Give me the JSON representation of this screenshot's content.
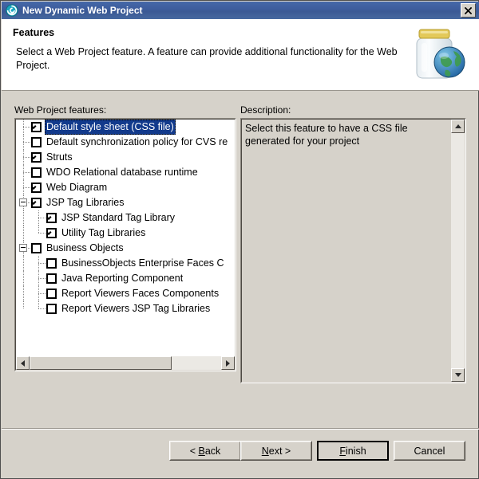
{
  "window": {
    "title": "New Dynamic Web Project",
    "icon": "spiral-icon",
    "close_label": "×",
    "title_bar_color": "#3d5c9c"
  },
  "header": {
    "title": "Features",
    "description": "Select a Web Project feature.  A feature can provide additional functionality for the Web Project.",
    "icon": "jar-globe-icon"
  },
  "labels": {
    "features": "Web Project features:",
    "description": "Description:"
  },
  "tree": {
    "selected_index": 0,
    "selection_color": "#123a8c",
    "items": [
      {
        "label": "Default style sheet (CSS file)",
        "checked": true,
        "level": 0,
        "expander": false,
        "selected": true
      },
      {
        "label": "Default synchronization policy for CVS re",
        "checked": false,
        "level": 0,
        "expander": false,
        "selected": false
      },
      {
        "label": "Struts",
        "checked": true,
        "level": 0,
        "expander": false,
        "selected": false
      },
      {
        "label": "WDO Relational database runtime",
        "checked": false,
        "level": 0,
        "expander": false,
        "selected": false
      },
      {
        "label": "Web Diagram",
        "checked": true,
        "level": 0,
        "expander": false,
        "selected": false
      },
      {
        "label": "JSP Tag Libraries",
        "checked": true,
        "level": 0,
        "expander": true,
        "selected": false
      },
      {
        "label": "JSP Standard Tag Library",
        "checked": true,
        "level": 1,
        "expander": false,
        "selected": false
      },
      {
        "label": "Utility Tag Libraries",
        "checked": true,
        "level": 1,
        "expander": false,
        "selected": false
      },
      {
        "label": "Business Objects",
        "checked": false,
        "level": 0,
        "expander": true,
        "selected": false
      },
      {
        "label": "BusinessObjects Enterprise Faces C",
        "checked": false,
        "level": 1,
        "expander": false,
        "selected": false
      },
      {
        "label": "Java Reporting Component",
        "checked": false,
        "level": 1,
        "expander": false,
        "selected": false
      },
      {
        "label": "Report Viewers Faces Components",
        "checked": false,
        "level": 1,
        "expander": false,
        "selected": false
      },
      {
        "label": "Report Viewers JSP Tag Libraries",
        "checked": false,
        "level": 1,
        "expander": false,
        "selected": false
      }
    ]
  },
  "description_panel": {
    "text": "Select this feature to have a CSS file generated for your project"
  },
  "buttons": {
    "back": {
      "label": "< Back",
      "mnemonic": "B",
      "default": false
    },
    "next": {
      "label": "Next >",
      "mnemonic": "N",
      "default": false
    },
    "finish": {
      "label": "Finish",
      "mnemonic": "F",
      "default": true
    },
    "cancel": {
      "label": "Cancel",
      "mnemonic": "",
      "default": false
    }
  }
}
